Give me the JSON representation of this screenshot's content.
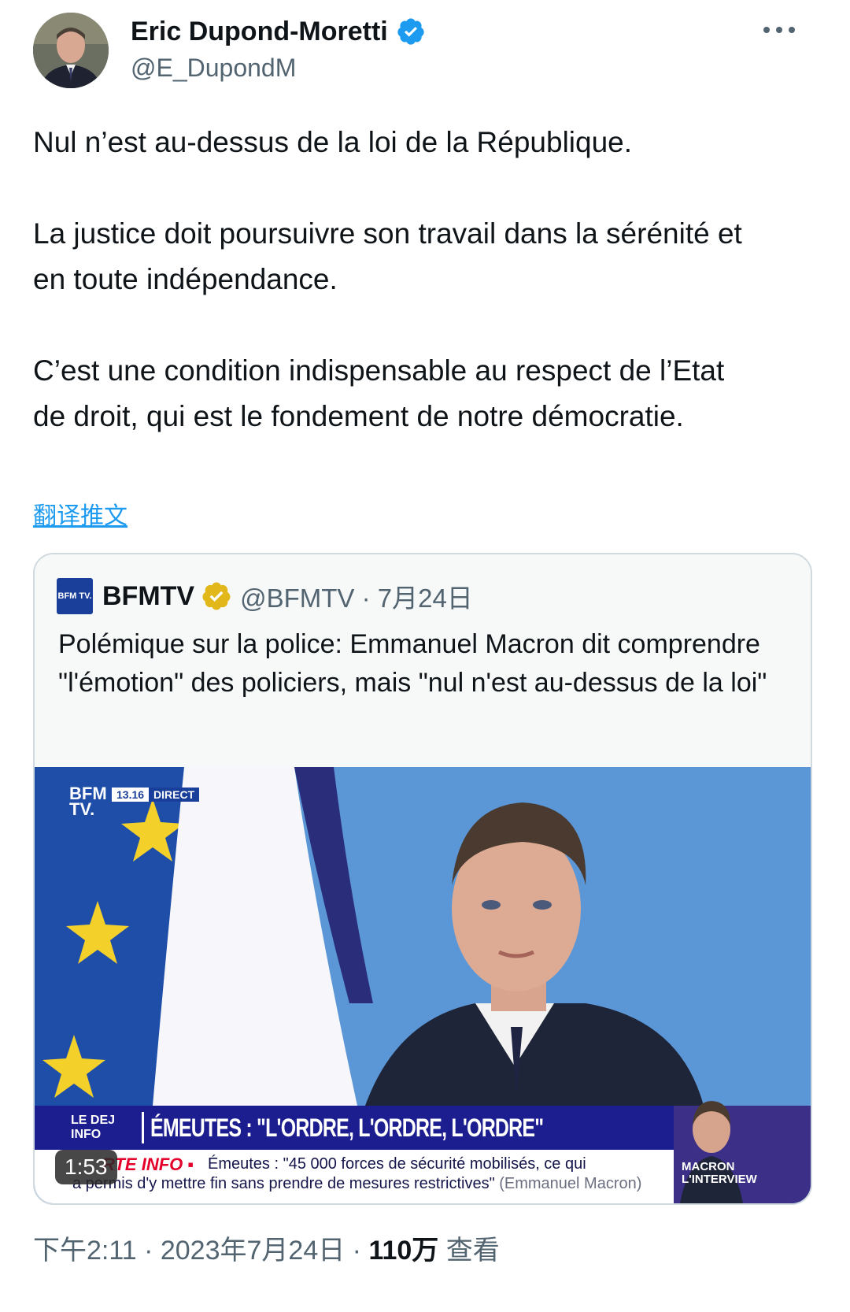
{
  "author": {
    "name": "Eric Dupond-Moretti",
    "handle": "@E_DupondM"
  },
  "tweet": {
    "paragraphs": [
      "Nul n’est au-dessus de la loi de la République.",
      "La justice doit poursuivre son travail dans la sérénité et en toute indépendance.",
      "C’est une condition indispensable au respect de l’Etat de droit, qui est le fondement de notre démocratie."
    ],
    "translate_label": "翻译推文"
  },
  "quoted": {
    "logo_text": "BFM TV.",
    "name": "BFMTV",
    "handle_and_date": "@BFMTV · 7月24日",
    "text": "Polémique sur la police: Emmanuel Macron dit comprendre \"l'émotion\" des policiers, mais \"nul n'est au-dessus de la loi\"",
    "video": {
      "bug_logo": "BFM TV.",
      "bug_time": "13.16",
      "bug_status": "DIRECT",
      "lower_logo": "LE DEJ INFO",
      "headline": "ÉMEUTES : \"L'ORDRE, L'ORDRE, L'ORDRE\"",
      "ticker_label": "RTE INFO ▪",
      "ticker_line1": "Émeutes : \"45 000 forces de sécurité mobilisés, ce qui",
      "ticker_line2": "a permis d'y mettre fin sans prendre de mesures restrictives\"",
      "ticker_source": "(Emmanuel Macron)",
      "side_label_1": "MACRON",
      "side_label_2": "L'INTERVIEW",
      "duration": "1:53"
    }
  },
  "footer": {
    "time_date": "下午2:11 · 2023年7月24日 · ",
    "views": "110万",
    "views_label": " 查看"
  },
  "colors": {
    "verified_blue": "#1d9bf0",
    "verified_gold": "#e2b719",
    "link": "#1d9bf0",
    "secondary_text": "#536471",
    "bfm_blue": "#1a3f9a"
  }
}
